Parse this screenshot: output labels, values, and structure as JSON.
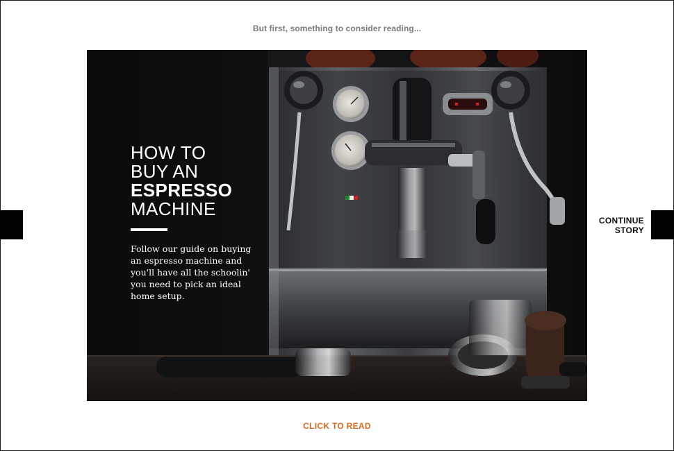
{
  "intro_text": "But first, something to consider reading...",
  "hero": {
    "headline_line1": "HOW TO",
    "headline_line2": "BUY AN",
    "headline_line3": "ESPRESSO",
    "headline_line4": "MACHINE",
    "description": "Follow our guide on buying an espresso machine and you'll have all the schoolin' you need to pick an ideal home setup."
  },
  "continue_line1": "CONTINUE",
  "continue_line2": "STORY",
  "cta_label": "CLICK TO READ",
  "colors": {
    "accent": "#d9691e",
    "intro_text": "#7a7a7a",
    "tab": "#000000"
  },
  "icons": {
    "left_tab": "left-nav-tab",
    "right_tab": "right-nav-tab"
  }
}
